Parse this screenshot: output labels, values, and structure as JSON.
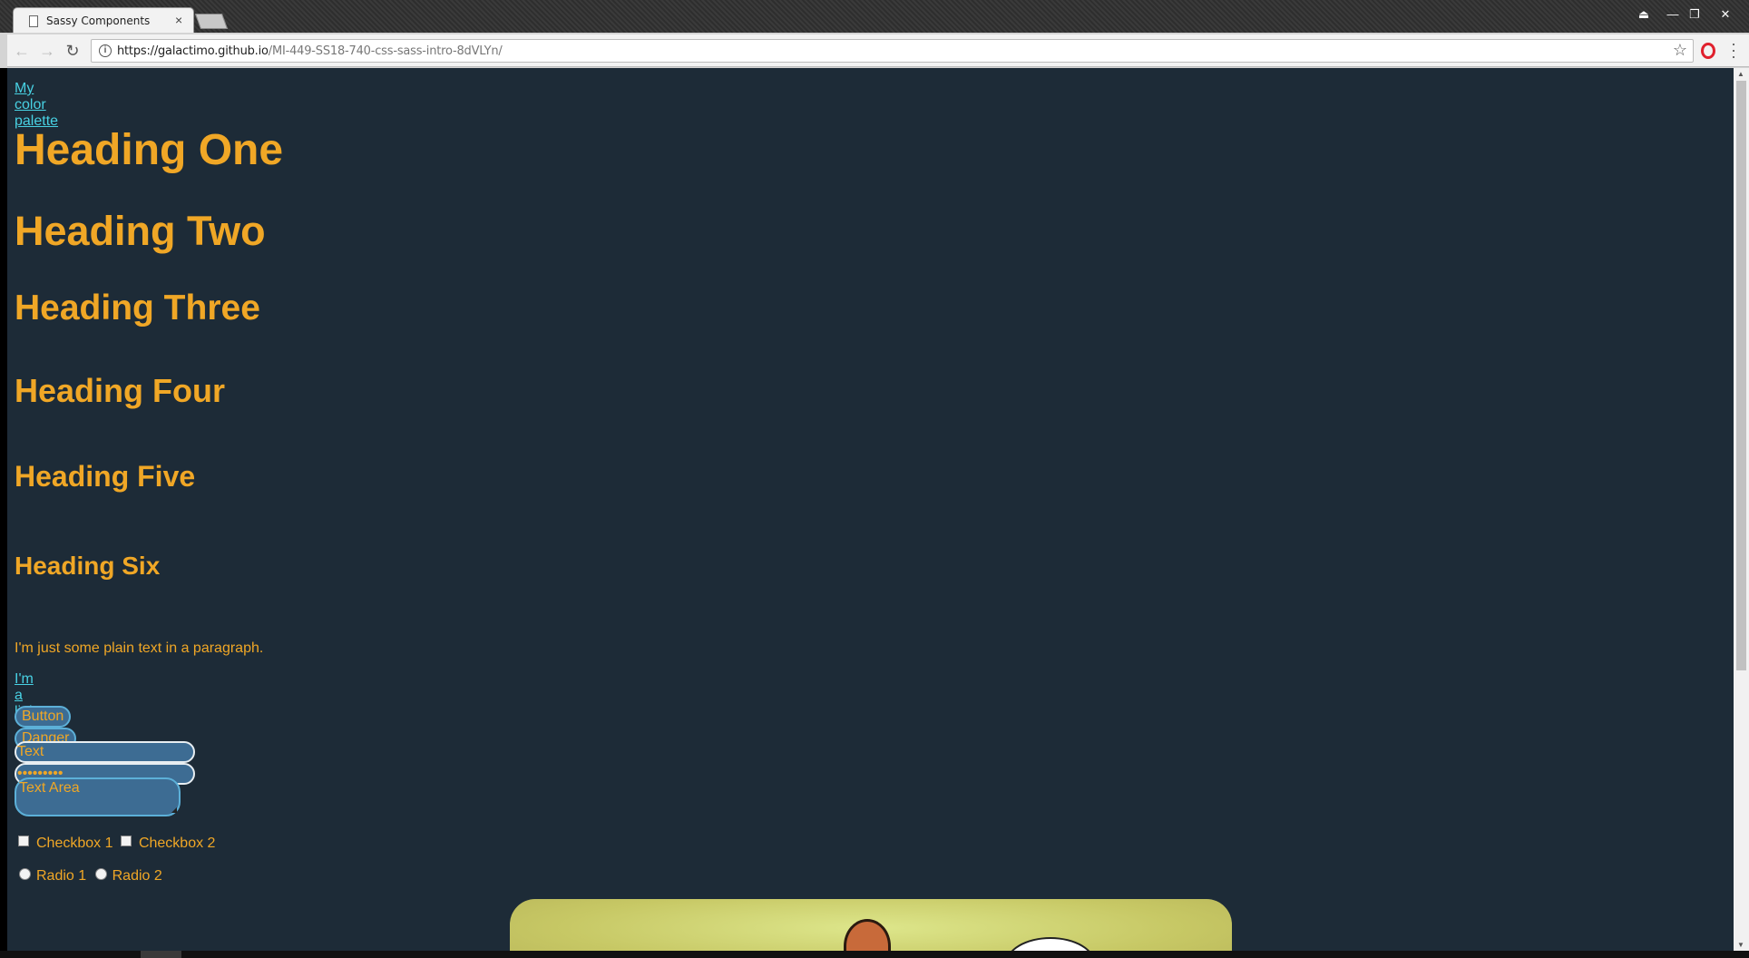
{
  "browser": {
    "tab_title": "Sassy Components",
    "tab_close": "×",
    "url_host": "https://galactimo.github.io",
    "url_path": "/MI-449-SS18-740-css-sass-intro-8dVLYn/",
    "icons": [
      "page-icon",
      "back-icon",
      "forward-icon",
      "reload-icon",
      "info-icon",
      "star-icon",
      "opera-icon",
      "menu-icon",
      "profile-icon",
      "minimize-icon",
      "restore-icon",
      "close-icon"
    ]
  },
  "page": {
    "palette_link": "My color palette",
    "headings": {
      "h1": "Heading One",
      "h2": "Heading Two",
      "h3": "Heading Three",
      "h4": "Heading Four",
      "h5": "Heading Five",
      "h6": "Heading Six"
    },
    "paragraph": "I'm just some plain text in a paragraph.",
    "link": "I'm a link",
    "buttons": {
      "primary": "Button",
      "danger": "Danger"
    },
    "inputs": {
      "text_value": "Text",
      "password_value": "•••••••••"
    },
    "textarea_value": "Text Area",
    "checkboxes": [
      "Checkbox 1",
      "Checkbox 2"
    ],
    "radios": [
      "Radio 1",
      "Radio 2"
    ]
  },
  "colors": {
    "background": "#1d2b37",
    "accent": "#f0a726",
    "link": "#48d1e3",
    "control_fill": "#3d6c93"
  }
}
